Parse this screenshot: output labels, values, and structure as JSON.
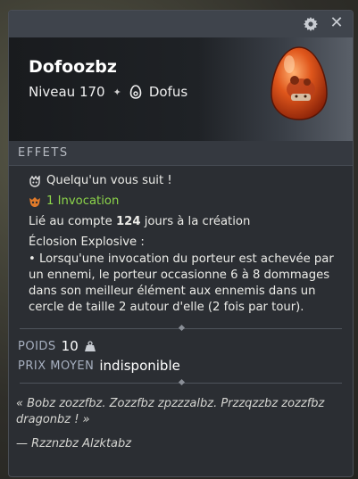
{
  "header": {
    "item_name": "Dofoozbz",
    "level_label": "Niveau 170",
    "separator": "✦",
    "category": "Dofus"
  },
  "icons": {
    "settings": "gear-icon",
    "close": "close-icon",
    "category": "dofus-egg-icon",
    "follower": "follower-icon",
    "summon": "summon-icon",
    "weight": "weight-icon"
  },
  "effects": {
    "title": "EFFETS",
    "line1": "Quelqu'un vous suit !",
    "summon_count": "1",
    "summon_label": "Invocation",
    "bound_prefix": "Lié au compte ",
    "bound_days": "124",
    "bound_suffix": " jours à la création",
    "explosive_title": "Éclosion Explosive :",
    "explosive_desc": "• Lorsqu'une invocation du porteur est achevée par un ennemi, le porteur occasionne 6 à 8 dommages dans son meilleur élément aux ennemis dans un cercle de taille 2 autour d'elle (2 fois par tour)."
  },
  "stats": {
    "weight_label": "POIDS",
    "weight_value": "10",
    "price_label": "PRIX MOYEN",
    "price_value": "indisponible"
  },
  "lore": {
    "quote": "« Bobz zozzfbz. Zozzfbz zpzzzalbz. Przzqzzbz zozzfbz dragonbz ! »",
    "author": "— Rzznzbz Alzktabz"
  },
  "colors": {
    "green_accent": "#8cd44a",
    "stat_label": "#a7b0c0"
  }
}
